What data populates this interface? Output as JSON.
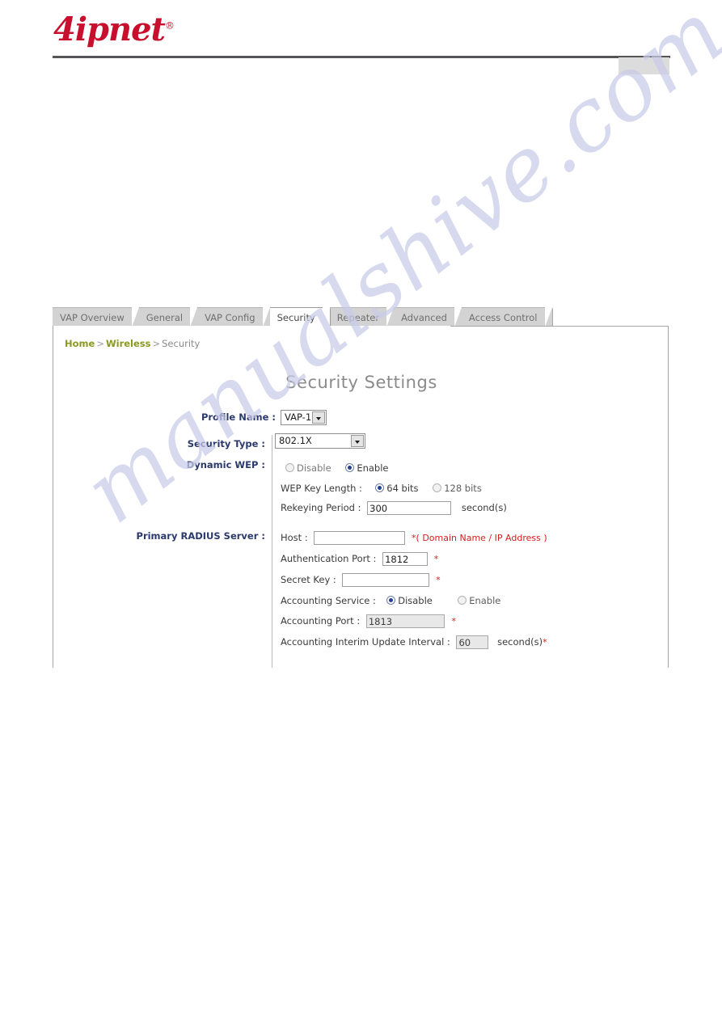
{
  "brand": {
    "logo_text": "4ipnet",
    "logo_registered": "®"
  },
  "tabs": [
    {
      "label": "VAP Overview",
      "active": false
    },
    {
      "label": "General",
      "active": false
    },
    {
      "label": "VAP Config",
      "active": false
    },
    {
      "label": "Security",
      "active": true
    },
    {
      "label": "Repeater",
      "active": false
    },
    {
      "label": "Advanced",
      "active": false
    },
    {
      "label": "Access Control",
      "active": false
    }
  ],
  "breadcrumb": {
    "home": "Home",
    "sep1": ">",
    "section": "Wireless",
    "sep2": ">",
    "current": "Security"
  },
  "page": {
    "title": "Security Settings"
  },
  "form": {
    "profile_name_label": "Profile Name :",
    "profile_name_value": "VAP-1",
    "security_type_label": "Security Type :",
    "security_type_value": "802.1X",
    "dynamic_wep_label": "Dynamic WEP :",
    "dynamic_wep_disable": "Disable",
    "dynamic_wep_enable": "Enable",
    "wep_key_length_label": "WEP Key Length :",
    "wep_key_64": "64 bits",
    "wep_key_128": "128 bits",
    "rekeying_label": "Rekeying Period :",
    "rekeying_value": "300",
    "rekeying_unit": "second(s)",
    "primary_radius_label": "Primary RADIUS Server :",
    "host_label": "Host :",
    "host_value": "",
    "host_hint": "*( Domain Name / IP Address )",
    "auth_port_label": "Authentication Port :",
    "auth_port_value": "1812",
    "auth_port_req": "*",
    "secret_key_label": "Secret Key :",
    "secret_key_value": "",
    "secret_key_req": "*",
    "accounting_service_label": "Accounting Service :",
    "accounting_disable": "Disable",
    "accounting_enable": "Enable",
    "accounting_port_label": "Accounting Port :",
    "accounting_port_value": "1813",
    "accounting_port_req": "*",
    "interim_label": "Accounting Interim Update Interval :",
    "interim_value": "60",
    "interim_unit": "second(s)",
    "interim_req": "*"
  },
  "watermark": {
    "text": "manualshive.com"
  },
  "colors": {
    "brand_red": "#c8102e",
    "label_blue": "#2b3a6b",
    "breadcrumb_green": "#8a9a1f",
    "required_red": "#d81b1b",
    "title_gray": "#8b8b8b"
  }
}
